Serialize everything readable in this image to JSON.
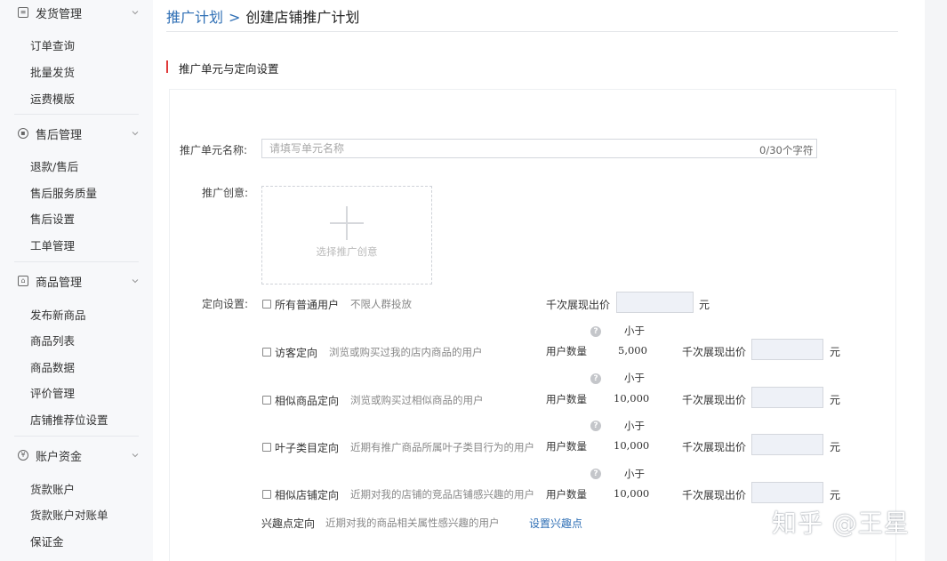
{
  "sidebar": {
    "groups": [
      {
        "title": "发货管理",
        "icon": "document-icon",
        "items": [
          "订单查询",
          "批量发货",
          "运费模版"
        ]
      },
      {
        "title": "售后管理",
        "icon": "shield-icon",
        "items": [
          "退款/售后",
          "售后服务质量",
          "售后设置",
          "工单管理"
        ]
      },
      {
        "title": "商品管理",
        "icon": "bag-icon",
        "items": [
          "发布新商品",
          "商品列表",
          "商品数据",
          "评价管理",
          "店铺推荐位设置"
        ]
      },
      {
        "title": "账户资金",
        "icon": "yen-icon",
        "items": [
          "货款账户",
          "货款账户对账单",
          "保证金"
        ]
      }
    ]
  },
  "breadcrumb": {
    "parent": "推广计划",
    "separator": ">",
    "current": "创建店铺推广计划"
  },
  "section": {
    "title": "推广单元与定向设置"
  },
  "form": {
    "unit_name_label": "推广单元名称:",
    "unit_name_placeholder": "请填写单元名称",
    "unit_name_counter": "0/30个字符",
    "creative_label": "推广创意:",
    "creative_hint": "选择推广创意",
    "targeting_label": "定向设置:",
    "price_label": "千次展现出价",
    "unit": "元",
    "user_count_label": "用户数量",
    "less_than": "小于",
    "options": [
      {
        "label": "所有普通用户",
        "desc": "不限人群投放"
      },
      {
        "label": "访客定向",
        "desc": "浏览或购买过我的店内商品的用户",
        "count": "5,000"
      },
      {
        "label": "相似商品定向",
        "desc": "浏览或购买过相似商品的用户",
        "count": "10,000"
      },
      {
        "label": "叶子类目定向",
        "desc": "近期有推广商品所属叶子类目行为的用户",
        "count": "10,000"
      },
      {
        "label": "相似店铺定向",
        "desc": "近期对我的店铺的竞品店铺感兴趣的用户",
        "count": "10,000"
      }
    ],
    "interest": {
      "label": "兴趣点定向",
      "desc": "近期对我的商品相关属性感兴趣的用户",
      "link": "设置兴趣点"
    }
  },
  "watermark": "知乎 @王星",
  "colors": {
    "link": "#2f6fb5",
    "accent_bar": "#e03a3a",
    "input_bg": "#eef1f7"
  }
}
